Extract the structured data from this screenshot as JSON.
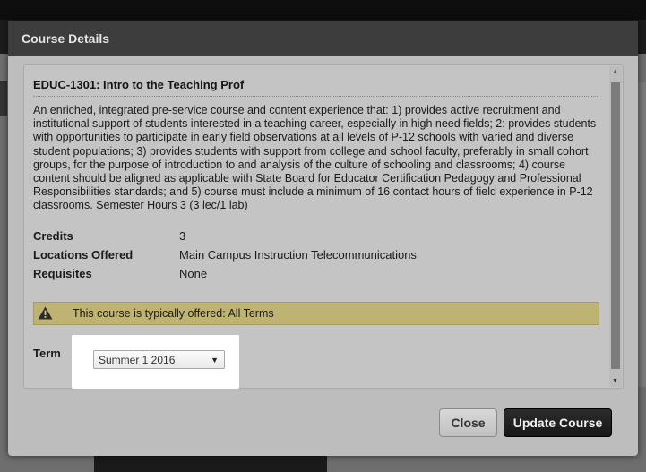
{
  "modal": {
    "title": "Course Details",
    "course_title": "EDUC-1301: Intro to the Teaching Prof",
    "description": "An enriched, integrated pre-service course and content experience that: 1) provides active recruitment and institutional support of students interested in a teaching career, especially in high need fields; 2: provides students with opportunities to participate in early field observations at all levels of P-12 schools with varied and diverse student populations; 3) provides students with support from college and school faculty, preferably in small cohort groups, for the purpose of introduction to and analysis of the culture of schooling and classrooms; 4) course content should be aligned as applicable with State Board for Educator Certification Pedagogy and Professional Responsibilities standards; and 5) course must include a minimum of 16 contact hours of field experience in P-12 classrooms. Semester Hours 3 (3 lec/1 lab)",
    "info": {
      "credits_label": "Credits",
      "credits_value": "3",
      "locations_label": "Locations Offered",
      "locations_value": "Main Campus Instruction Telecommunications",
      "requisites_label": "Requisites",
      "requisites_value": "None"
    },
    "alert": {
      "text": "This course is typically offered: All Terms",
      "icon": "warning-icon"
    },
    "term": {
      "label": "Term",
      "selected": "Summer 1 2016"
    },
    "buttons": {
      "close": "Close",
      "update": "Update Course"
    }
  }
}
